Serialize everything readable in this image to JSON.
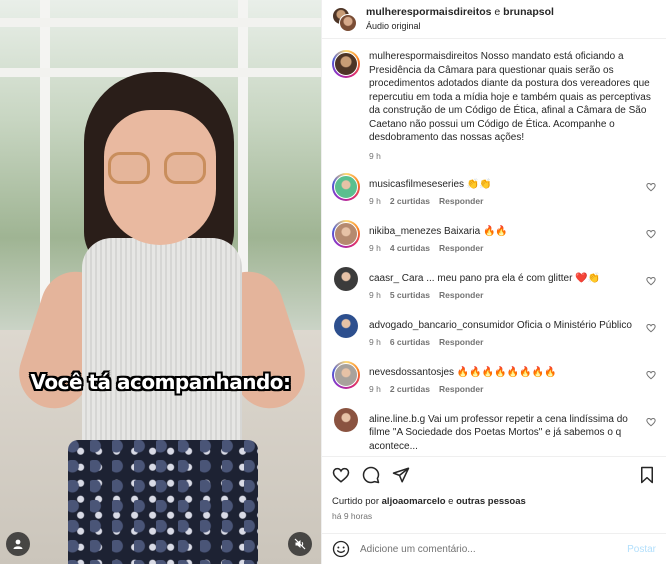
{
  "video": {
    "caption": "Você tá acompanhando:"
  },
  "header": {
    "author1": "mulherespormaisdireitos",
    "separator": " e ",
    "author2": "brunapsol",
    "audio": "Áudio original"
  },
  "post_caption": {
    "username": "mulherespormaisdireitos",
    "text": "Nosso mandato está oficiando a Presidência da Câmara para questionar quais serão os procedimentos adotados diante da postura dos vereadores que repercutiu em toda a mídia hoje e também quais as perceptivas da construção de um Código de Ética, afinal a Câmara de São Caetano não possui um Código de Ética. Acompanhe o desdobramento das nossas ações!",
    "time": "9 h"
  },
  "comments": [
    {
      "user": "musicasfilmeseseries",
      "text": "👏👏",
      "time": "9 h",
      "likes": "2 curtidas",
      "reply": "Responder",
      "avatar_color": "#5bbf8f",
      "ring": true
    },
    {
      "user": "nikiba_menezes",
      "text": "Baixaria 🔥🔥",
      "time": "9 h",
      "likes": "4 curtidas",
      "reply": "Responder",
      "avatar_color": "#b58a6f",
      "ring": true
    },
    {
      "user": "caasr_",
      "text": "Cara ... meu pano pra ela é com glitter ❤️👏",
      "time": "9 h",
      "likes": "5 curtidas",
      "reply": "Responder",
      "avatar_color": "#3b3b3b",
      "ring": false
    },
    {
      "user": "advogado_bancario_consumidor",
      "text": "Oficia o Ministério Público",
      "time": "9 h",
      "likes": "6 curtidas",
      "reply": "Responder",
      "avatar_color": "#2d4f8e",
      "ring": false
    },
    {
      "user": "nevesdossantosjes",
      "text": "🔥🔥🔥🔥🔥🔥🔥🔥",
      "time": "9 h",
      "likes": "2 curtidas",
      "reply": "Responder",
      "avatar_color": "#a8a29c",
      "ring": true
    },
    {
      "user": "aline.line.b.g",
      "text": "Vai um professor repetir a cena lindíssima do filme \"A Sociedade dos Poetas Mortos\" e já sabemos o q acontece...",
      "time": "",
      "likes": "",
      "reply": "",
      "avatar_color": "#8a5340",
      "ring": false
    }
  ],
  "likes_line": {
    "prefix": "Curtido por ",
    "user": "aljoaomarcelo",
    "suffix": " e ",
    "others": "outras pessoas"
  },
  "posted_time": "há 9 horas",
  "add_comment": {
    "placeholder": "Adicione um comentário...",
    "post_label": "Postar"
  },
  "colors": {
    "link_blue": "#b2dffc",
    "meta_gray": "#737373",
    "text": "#262626"
  },
  "icons": [
    "heart-icon",
    "comment-icon",
    "share-icon",
    "bookmark-icon",
    "emoji-icon",
    "user-icon",
    "mute-icon"
  ]
}
